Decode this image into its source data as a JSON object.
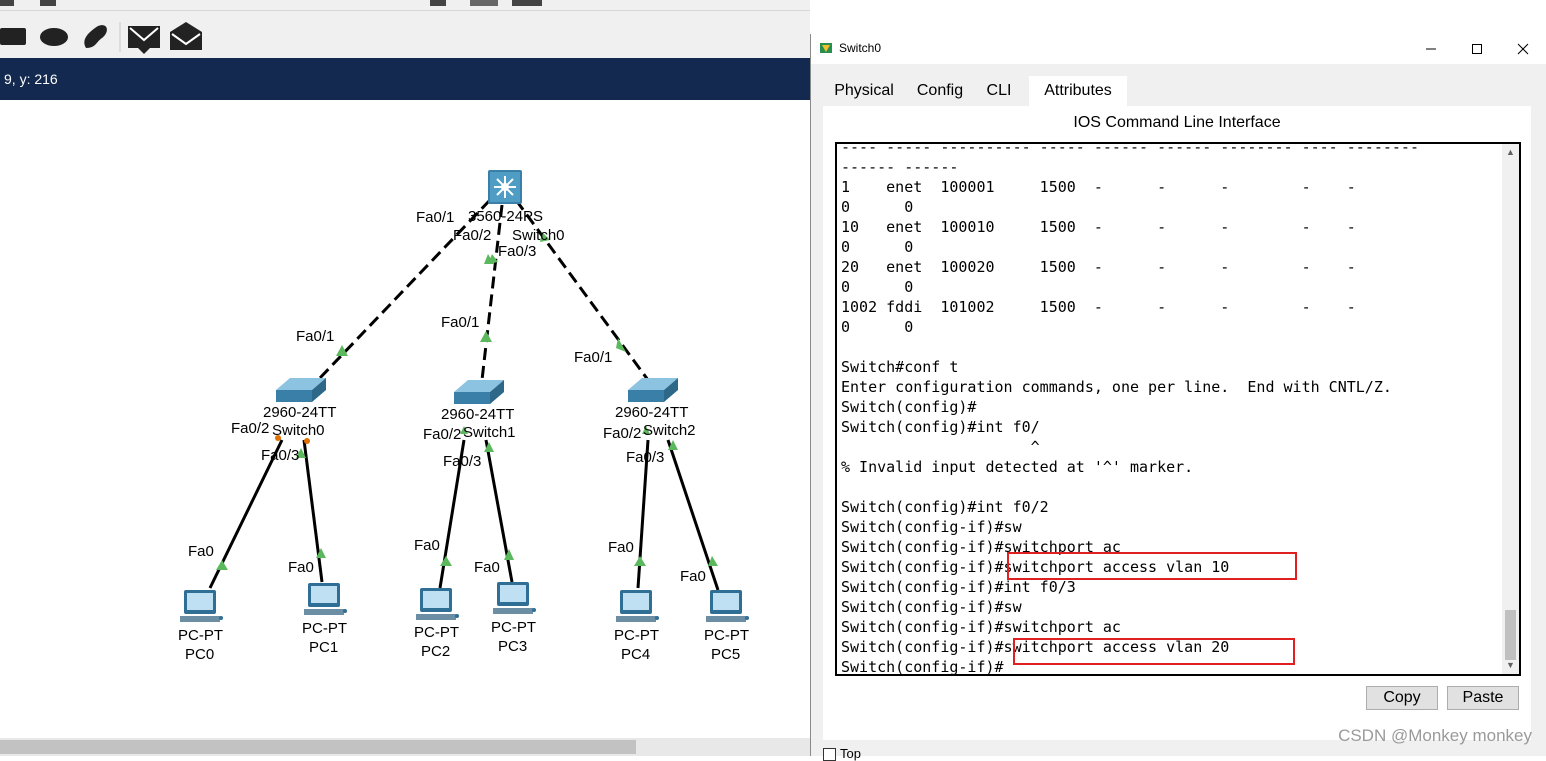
{
  "statusbar": {
    "coords": "9, y: 216"
  },
  "dialog": {
    "title": "Switch0",
    "tabs": [
      "Physical",
      "Config",
      "CLI",
      "Attributes"
    ],
    "active_tab": "CLI",
    "cli_title": "IOS Command Line Interface",
    "cli_lines": [
      "---- ----- ---------- ----- ------ ------ -------- ---- --------",
      "------ ------",
      "1    enet  100001     1500  -      -      -        -    -",
      "0      0",
      "10   enet  100010     1500  -      -      -        -    -",
      "0      0",
      "20   enet  100020     1500  -      -      -        -    -",
      "0      0",
      "1002 fddi  101002     1500  -      -      -        -    -",
      "0      0",
      "",
      "Switch#conf t",
      "Enter configuration commands, one per line.  End with CNTL/Z.",
      "Switch(config)#",
      "Switch(config)#int f0/",
      "                     ^",
      "% Invalid input detected at '^' marker.",
      "",
      "Switch(config)#int f0/2",
      "Switch(config-if)#sw",
      "Switch(config-if)#switchport ac",
      "Switch(config-if)#switchport access vlan 10",
      "Switch(config-if)#int f0/3",
      "Switch(config-if)#sw",
      "Switch(config-if)#switchport ac",
      "Switch(config-if)#switchport access vlan 20",
      "Switch(config-if)#"
    ],
    "copy_label": "Copy",
    "paste_label": "Paste",
    "top_label": "Top"
  },
  "watermark": "CSDN @Monkey monkey",
  "topology": {
    "core": {
      "model": "3560-24PS",
      "name": "Switch0"
    },
    "core_ports": [
      "Fa0/1",
      "Fa0/2",
      "Fa0/3"
    ],
    "switches": [
      {
        "model": "2960-24TT",
        "name": "Switch0",
        "uplink": "Fa0/1",
        "p2": "Fa0/2",
        "p3": "Fa0/3"
      },
      {
        "model": "2960-24TT",
        "name": "Switch1",
        "uplink": "Fa0/1",
        "p2": "Fa0/2",
        "p3": "Fa0/3"
      },
      {
        "model": "2960-24TT",
        "name": "Switch2",
        "uplink": "Fa0/1",
        "p2": "Fa0/2",
        "p3": "Fa0/3"
      }
    ],
    "pcs": [
      {
        "model": "PC-PT",
        "name": "PC0",
        "port": "Fa0"
      },
      {
        "model": "PC-PT",
        "name": "PC1",
        "port": "Fa0"
      },
      {
        "model": "PC-PT",
        "name": "PC2",
        "port": "Fa0"
      },
      {
        "model": "PC-PT",
        "name": "PC3",
        "port": "Fa0"
      },
      {
        "model": "PC-PT",
        "name": "PC4",
        "port": "Fa0"
      },
      {
        "model": "PC-PT",
        "name": "PC5",
        "port": "Fa0"
      }
    ],
    "colors": {
      "link_up": "#5cb85c",
      "link_down": "#e07000",
      "statusbar": "#13294f"
    }
  }
}
